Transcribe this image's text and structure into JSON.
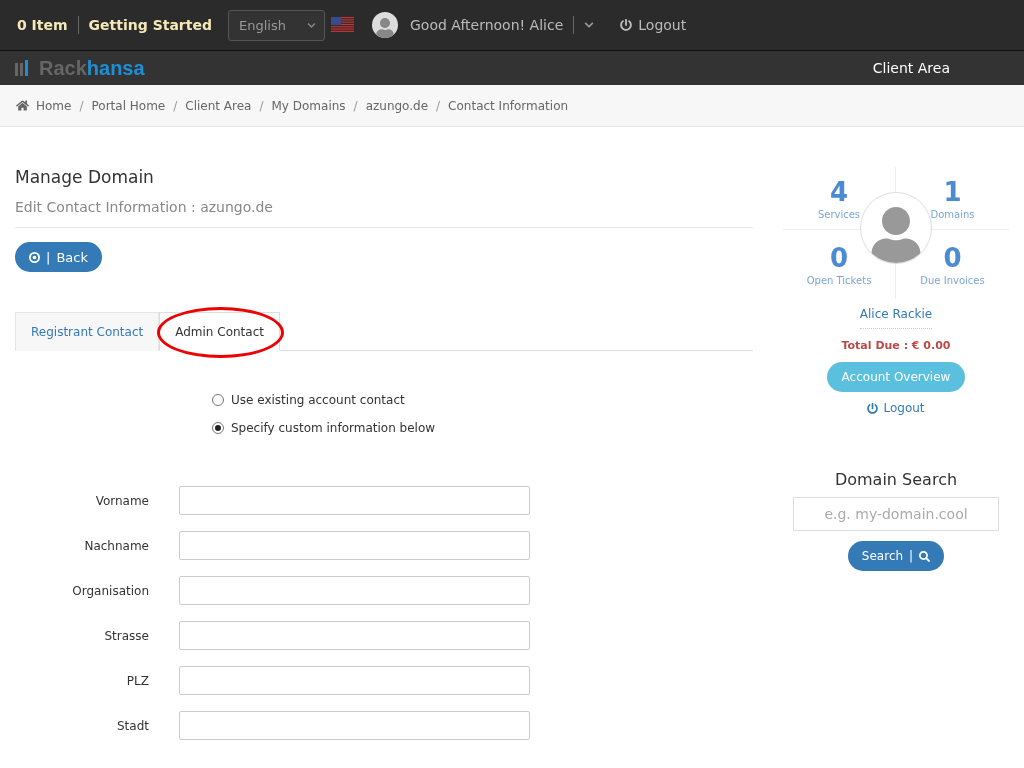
{
  "top_bar": {
    "cart": "0 Item",
    "getting_started": "Getting Started",
    "language": "English",
    "greeting": "Good Afternoon! Alice",
    "logout": "Logout"
  },
  "brand": {
    "logo_part_1": "Rack",
    "logo_part_2": "hansa",
    "nav_item": "Client Area"
  },
  "breadcrumb": [
    {
      "label": "Home"
    },
    {
      "separator": "/",
      "label": "Portal Home"
    },
    {
      "separator": "/",
      "label": "Client Area"
    },
    {
      "separator": "/",
      "label": "My Domains"
    },
    {
      "separator": "/",
      "label": "azungo.de"
    },
    {
      "separator": "/",
      "label": "Contact Information"
    }
  ],
  "page": {
    "title": "Manage Domain",
    "subtitle": "Edit Contact Information : azungo.de",
    "back_divider": "|",
    "back_button": "Back"
  },
  "tabs": [
    {
      "label": "Registrant Contact",
      "selected": false
    },
    {
      "label": "Admin Contact",
      "selected": true
    }
  ],
  "contact_options": [
    {
      "label": "Use existing account contact",
      "selected": false
    },
    {
      "label": "Specify custom information below",
      "selected": true
    }
  ],
  "fields": [
    {
      "label": "Vorname"
    },
    {
      "label": "Nachname"
    },
    {
      "label": "Organisation"
    },
    {
      "label": "Strasse"
    },
    {
      "label": "PLZ"
    },
    {
      "label": "Stadt"
    }
  ],
  "sidebar": {
    "stats": [
      {
        "value": "4",
        "label": "Services"
      },
      {
        "value": "1",
        "label": "Domains"
      },
      {
        "value": "0",
        "label": "Open Tickets"
      },
      {
        "value": "0",
        "label": "Due Invoices"
      }
    ],
    "user_name": "Alice Rackie",
    "total_due": "Total Due : € 0.00",
    "account_button": "Account Overview",
    "logout": "Logout",
    "search_title": "Domain Search",
    "search_placeholder": "e.g. my-domain.cool",
    "search_button": "Search",
    "search_divider": "|"
  }
}
